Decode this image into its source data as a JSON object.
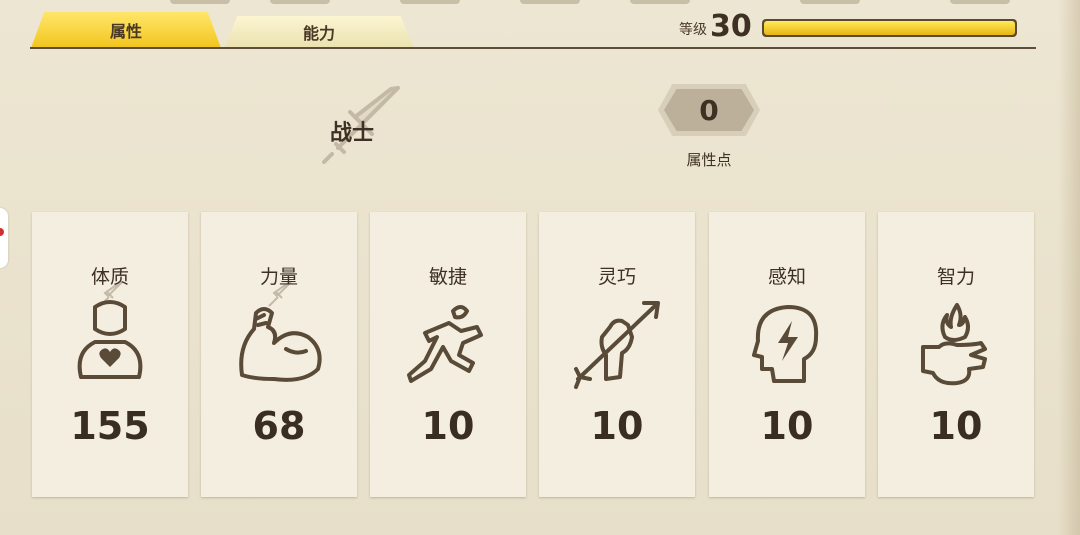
{
  "tabs": [
    {
      "label": "属性",
      "active": true
    },
    {
      "label": "能力",
      "active": false
    }
  ],
  "level": {
    "label": "等级",
    "value": "30",
    "xp_fraction": 1.0
  },
  "character": {
    "class_name": "战士"
  },
  "attribute_points": {
    "value": "0",
    "label": "属性点"
  },
  "stats": [
    {
      "label": "体质",
      "value": "155",
      "icon": "body-heart-icon"
    },
    {
      "label": "力量",
      "value": "68",
      "icon": "flexed-arm-icon"
    },
    {
      "label": "敏捷",
      "value": "10",
      "icon": "running-figure-icon"
    },
    {
      "label": "灵巧",
      "value": "10",
      "icon": "hand-arrow-icon"
    },
    {
      "label": "感知",
      "value": "10",
      "icon": "head-lightning-icon"
    },
    {
      "label": "智力",
      "value": "10",
      "icon": "hand-flame-icon"
    }
  ],
  "colors": {
    "accent": "#f2c51e",
    "text": "#3e3024",
    "panel": "#f3eedf",
    "background": "#e9e2cd"
  }
}
